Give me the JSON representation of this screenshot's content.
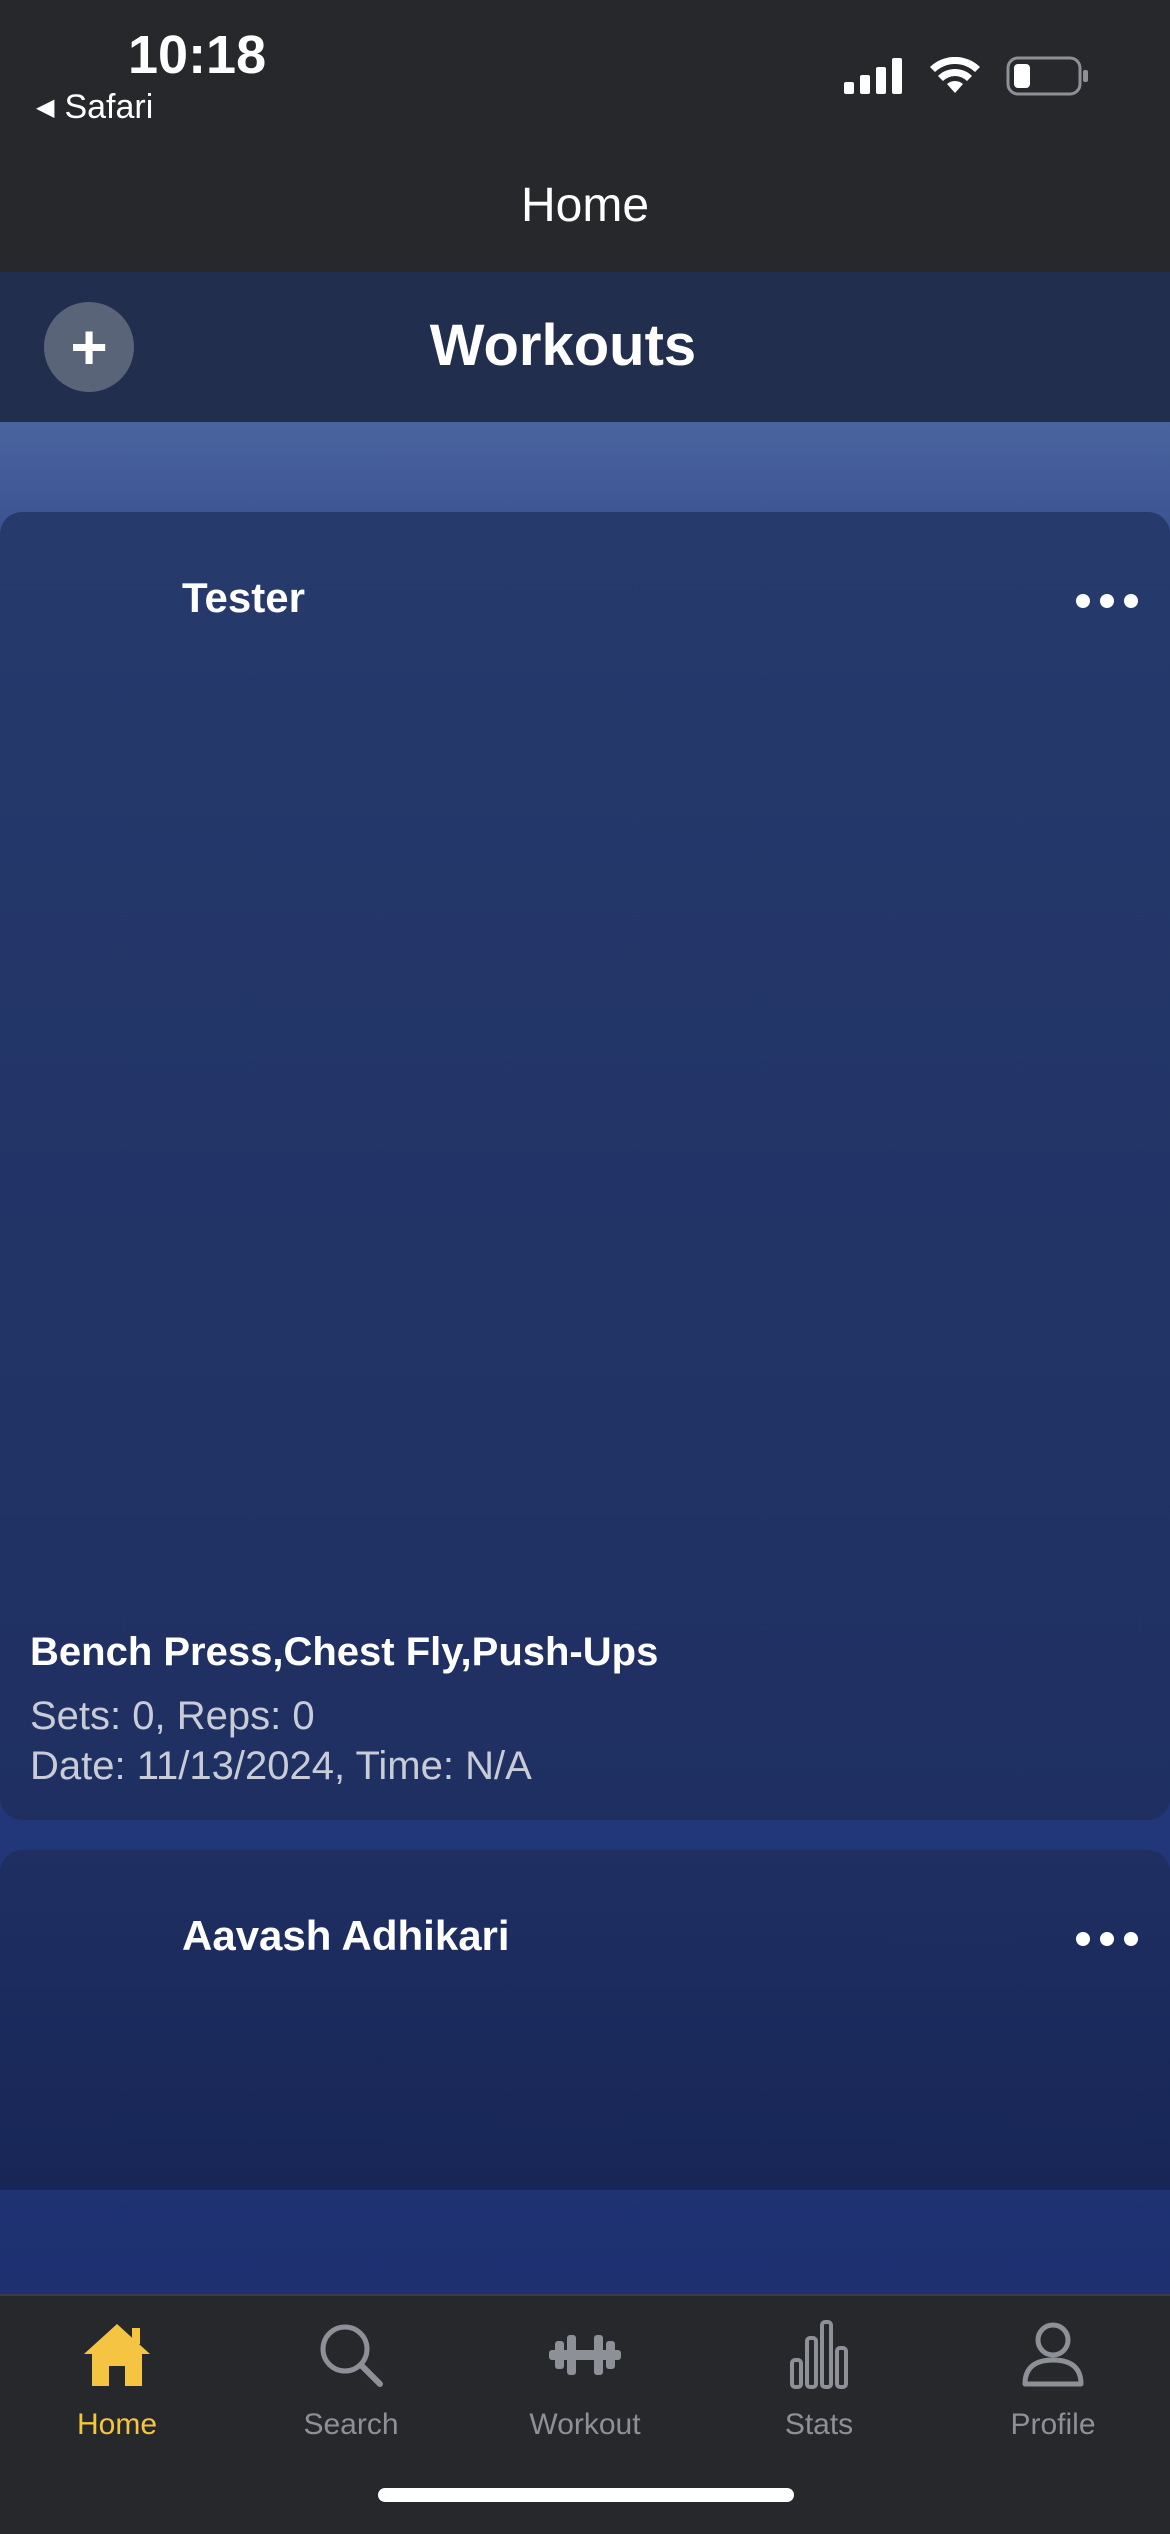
{
  "status_bar": {
    "time": "10:18",
    "back_app": "Safari",
    "icons": [
      "signal-icon",
      "wifi-icon",
      "battery-icon"
    ]
  },
  "nav": {
    "title": "Home"
  },
  "workouts_bar": {
    "title": "Workouts",
    "add_icon": "plus-icon"
  },
  "cards": [
    {
      "user": "Tester",
      "exercises": "Bench Press,Chest Fly,Push-Ups",
      "sets_reps": "Sets: 0, Reps: 0",
      "date_time": "Date: 11/13/2024, Time: N/A"
    },
    {
      "user": "Aavash Adhikari"
    }
  ],
  "tabs": [
    {
      "label": "Home",
      "icon": "home-icon",
      "active": true
    },
    {
      "label": "Search",
      "icon": "search-icon",
      "active": false
    },
    {
      "label": "Workout",
      "icon": "dumbbell-icon",
      "active": false
    },
    {
      "label": "Stats",
      "icon": "bar-chart-icon",
      "active": false
    },
    {
      "label": "Profile",
      "icon": "person-icon",
      "active": false
    }
  ],
  "colors": {
    "active_tab": "#f5c542",
    "inactive_tab": "#8e9097",
    "background": "#1f2d5e"
  }
}
